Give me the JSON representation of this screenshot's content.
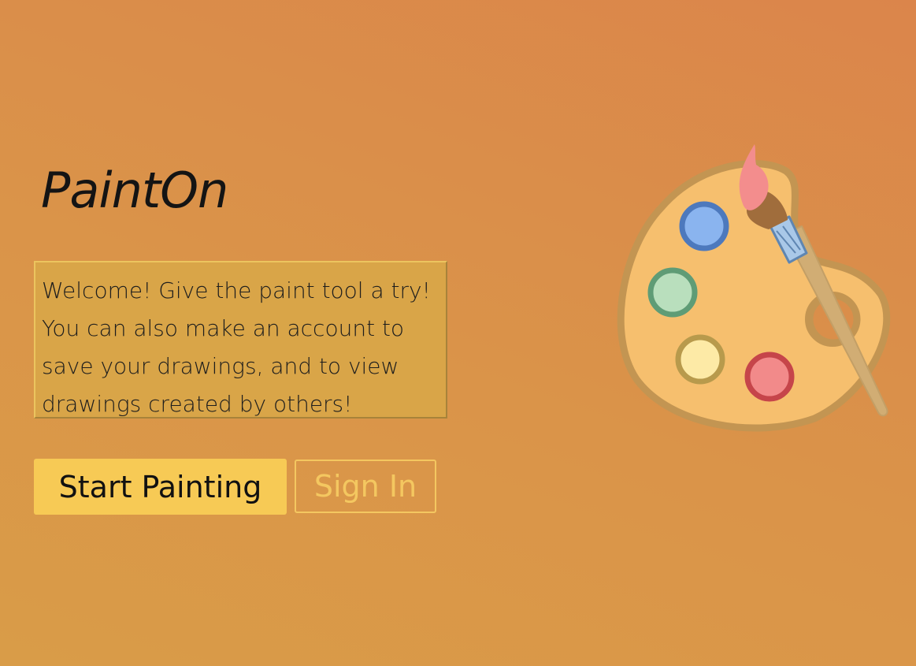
{
  "app": {
    "title": "PaintOn"
  },
  "welcome": {
    "message": "Welcome! Give the paint tool a try!\nYou can also make an account to\nsave your drawings, and to view\ndrawings created by others!"
  },
  "actions": {
    "start_label": "Start Painting",
    "signin_label": "Sign In"
  },
  "illustration": {
    "icon": "paint-palette-with-brush",
    "colors": {
      "palette": "#f6bf6e",
      "palette_rim": "#c39552",
      "paint_blue": "#8ab4ef",
      "paint_green": "#b9dfbd",
      "paint_yellow": "#fdeaa6",
      "paint_red": "#f28a8a",
      "brush_tip": "#f38d8d"
    }
  },
  "theme": {
    "background_top": "#db854b",
    "background_bottom": "#d99c48",
    "primary_button": "#f7ca55",
    "secondary_button_outline": "#f4c760"
  }
}
